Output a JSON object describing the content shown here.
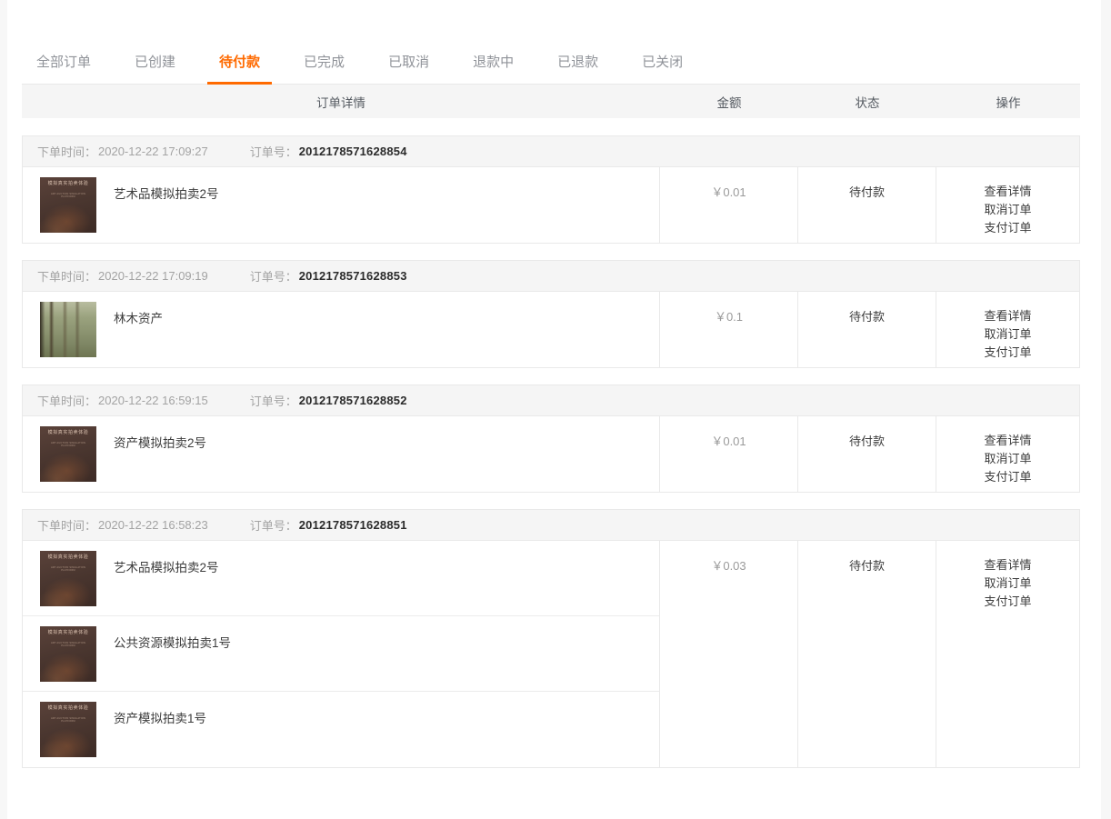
{
  "tabs": [
    {
      "label": "全部订单",
      "active": false
    },
    {
      "label": "已创建",
      "active": false
    },
    {
      "label": "待付款",
      "active": true
    },
    {
      "label": "已完成",
      "active": false
    },
    {
      "label": "已取消",
      "active": false
    },
    {
      "label": "退款中",
      "active": false
    },
    {
      "label": "已退款",
      "active": false
    },
    {
      "label": "已关闭",
      "active": false
    }
  ],
  "table": {
    "headers": {
      "detail": "订单详情",
      "amount": "金额",
      "status": "状态",
      "action": "操作"
    },
    "order_time_label": "下单时间：",
    "order_sn_label": "订单号：",
    "currency_symbol": "￥"
  },
  "orders": [
    {
      "time": "2020-12-22 17:09:27",
      "sn": "2012178571628854",
      "amount": "￥0.01",
      "status": "待付款",
      "actions": [
        "查看详情",
        "取消订单",
        "支付订单"
      ],
      "goods": [
        {
          "name": "艺术品模拟拍卖2号",
          "thumb": "art-auction-thumb",
          "thumb_caption": "模拟真实拍卖体验",
          "thumb_subcaption": "ART AUCTION SIMULATION PLATFORM"
        }
      ]
    },
    {
      "time": "2020-12-22 17:09:19",
      "sn": "2012178571628853",
      "amount": "￥0.1",
      "status": "待付款",
      "actions": [
        "查看详情",
        "取消订单",
        "支付订单"
      ],
      "goods": [
        {
          "name": "林木资产",
          "thumb": "forest-thumb",
          "thumb_caption": "",
          "thumb_subcaption": ""
        }
      ]
    },
    {
      "time": "2020-12-22 16:59:15",
      "sn": "2012178571628852",
      "amount": "￥0.01",
      "status": "待付款",
      "actions": [
        "查看详情",
        "取消订单",
        "支付订单"
      ],
      "goods": [
        {
          "name": "资产模拟拍卖2号",
          "thumb": "art-auction-thumb",
          "thumb_caption": "模拟真实拍卖体验",
          "thumb_subcaption": "ART AUCTION SIMULATION PLATFORM"
        }
      ]
    },
    {
      "time": "2020-12-22 16:58:23",
      "sn": "2012178571628851",
      "amount": "￥0.03",
      "status": "待付款",
      "actions": [
        "查看详情",
        "取消订单",
        "支付订单"
      ],
      "goods": [
        {
          "name": "艺术品模拟拍卖2号",
          "thumb": "art-auction-thumb",
          "thumb_caption": "模拟真实拍卖体验",
          "thumb_subcaption": "ART AUCTION SIMULATION PLATFORM"
        },
        {
          "name": "公共资源模拟拍卖1号",
          "thumb": "art-auction-thumb",
          "thumb_caption": "模拟真实拍卖体验",
          "thumb_subcaption": "ART AUCTION SIMULATION PLATFORM"
        },
        {
          "name": "资产模拟拍卖1号",
          "thumb": "art-auction-thumb",
          "thumb_caption": "模拟真实拍卖体验",
          "thumb_subcaption": "ART AUCTION SIMULATION PLATFORM"
        }
      ]
    }
  ],
  "colors": {
    "accent": "#ff6a00",
    "header_bg": "#f5f5f5",
    "border": "#e9e9e9",
    "page_bg": "#f7f7f7",
    "text_primary": "#3c3c3c",
    "text_muted": "#a3a3a3"
  }
}
